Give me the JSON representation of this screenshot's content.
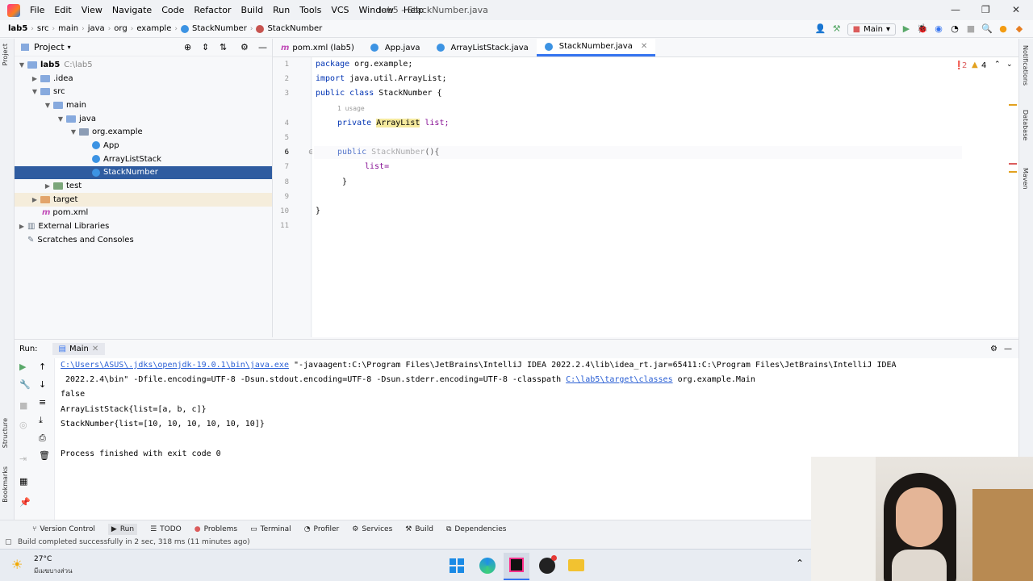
{
  "menubar": {
    "items": [
      "File",
      "Edit",
      "View",
      "Navigate",
      "Code",
      "Refactor",
      "Build",
      "Run",
      "Tools",
      "VCS",
      "Window",
      "Help"
    ],
    "window_title": "lab5 - StackNumber.java"
  },
  "navbar": {
    "crumbs": [
      "lab5",
      "src",
      "main",
      "java",
      "org",
      "example",
      "StackNumber",
      "StackNumber"
    ],
    "run_config": "Main"
  },
  "project": {
    "header": "Project",
    "tree": [
      {
        "label": "lab5",
        "extra": "C:\\lab5"
      },
      {
        "label": ".idea"
      },
      {
        "label": "src"
      },
      {
        "label": "main"
      },
      {
        "label": "java"
      },
      {
        "label": "org.example"
      },
      {
        "label": "App"
      },
      {
        "label": "ArrayListStack"
      },
      {
        "label": "StackNumber"
      },
      {
        "label": "test"
      },
      {
        "label": "target"
      },
      {
        "label": "pom.xml"
      },
      {
        "label": "External Libraries"
      },
      {
        "label": "Scratches and Consoles"
      }
    ]
  },
  "tabs": [
    "pom.xml (lab5)",
    "App.java",
    "ArrayListStack.java",
    "StackNumber.java"
  ],
  "editor": {
    "line_numbers": [
      "1",
      "2",
      "3",
      "4",
      "5",
      "6",
      "7",
      "8",
      "9",
      "10",
      "11"
    ],
    "code": {
      "l1_kw": "package",
      "l1_rest": " org.example;",
      "l2_kw": "import",
      "l2_rest": " java.util.ArrayList;",
      "l3_kw": "public class",
      "l3_name": " StackNumber",
      "l3_rest": " {",
      "usage_hint": "1 usage",
      "l4_kw": "private",
      "l4_type": "ArrayList",
      "l4_field": " list;",
      "l6_kw": "public",
      "l6_name": " StackNumber",
      "l6_rest": "(){",
      "l7": "list=",
      "l8": "}",
      "l10": "}"
    },
    "inspections": {
      "errors": "2",
      "warnings": "4"
    }
  },
  "run": {
    "label": "Run:",
    "tab": "Main",
    "console": {
      "cmd_path": "C:\\Users\\ASUS\\.jdks\\openjdk-19.0.1\\bin\\java.exe",
      "cmd_rest": " \"-javaagent:C:\\Program Files\\JetBrains\\IntelliJ IDEA 2022.2.4\\lib\\idea_rt.jar=65411:C:\\Program Files\\JetBrains\\IntelliJ IDEA",
      "cmd2_pre": " 2022.2.4\\bin\" -Dfile.encoding=UTF-8 -Dsun.stdout.encoding=UTF-8 -Dsun.stderr.encoding=UTF-8 -classpath ",
      "cmd2_link": "C:\\lab5\\target\\classes",
      "cmd2_post": " org.example.Main",
      "out1": "false",
      "out2": "ArrayListStack{list=[a, b, c]}",
      "out3": "StackNumber{list=[10, 10, 10, 10, 10, 10]}",
      "exit": "Process finished with exit code 0"
    }
  },
  "toolwindows": [
    "Version Control",
    "Run",
    "TODO",
    "Problems",
    "Terminal",
    "Profiler",
    "Services",
    "Build",
    "Dependencies"
  ],
  "status": "Build completed successfully in 2 sec, 318 ms (11 minutes ago)",
  "taskbar": {
    "temp": "27°C",
    "weather": "มีเมฆบางส่วน"
  },
  "colors": {
    "selection": "#2f5ca0",
    "accent": "#3574f0",
    "link": "#2a5fd4"
  }
}
